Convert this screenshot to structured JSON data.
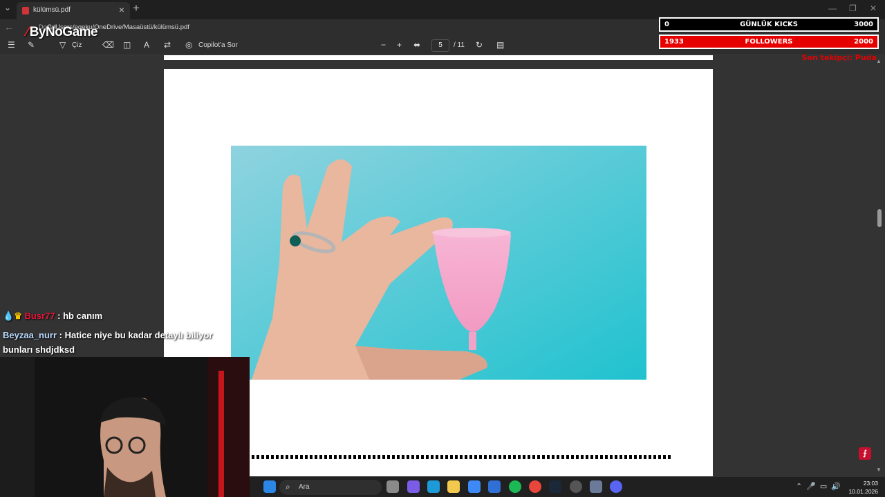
{
  "tab": {
    "title": "külümsü.pdf",
    "close": "×",
    "new_tab": "+",
    "tab_list": "⌄"
  },
  "window": {
    "minimize": "—",
    "restore": "❐",
    "close": "✕"
  },
  "address": {
    "prefix": "Dosya",
    "path": "C:/Users/egeku/OneDrive/Masaüstü/külümsü.pdf"
  },
  "toolbar": {
    "draw_label": "Çiz",
    "copilot_label": "Copilot'a Sor",
    "zoom_out": "−",
    "zoom_in": "+",
    "current_page": "5",
    "total_pages": "/ 11"
  },
  "overlay": {
    "logo": "ByNoGame",
    "kicks": {
      "left": "0",
      "label": "GÜNLÜK KICKS",
      "right": "3000"
    },
    "followers": {
      "left": "1933",
      "label": "FOLLOWERS",
      "right": "2000"
    },
    "last_follower": "Son takipçi: Puda"
  },
  "chat": [
    {
      "user": "Busr77",
      "message": ": hb canım"
    },
    {
      "user": "Beyzaa_nurr",
      "message": ": Hatice niye bu kadar detaylı biliyor bunları shdjdksd"
    }
  ],
  "taskbar": {
    "search_label": "Ara",
    "time": "23:03",
    "date": "10.01.2026"
  },
  "colors": {
    "accent_red": "#e60000",
    "page_bg": "#ffffff",
    "photo_bg": "#4cc6d8",
    "cup_pink": "#f5a3c7"
  }
}
